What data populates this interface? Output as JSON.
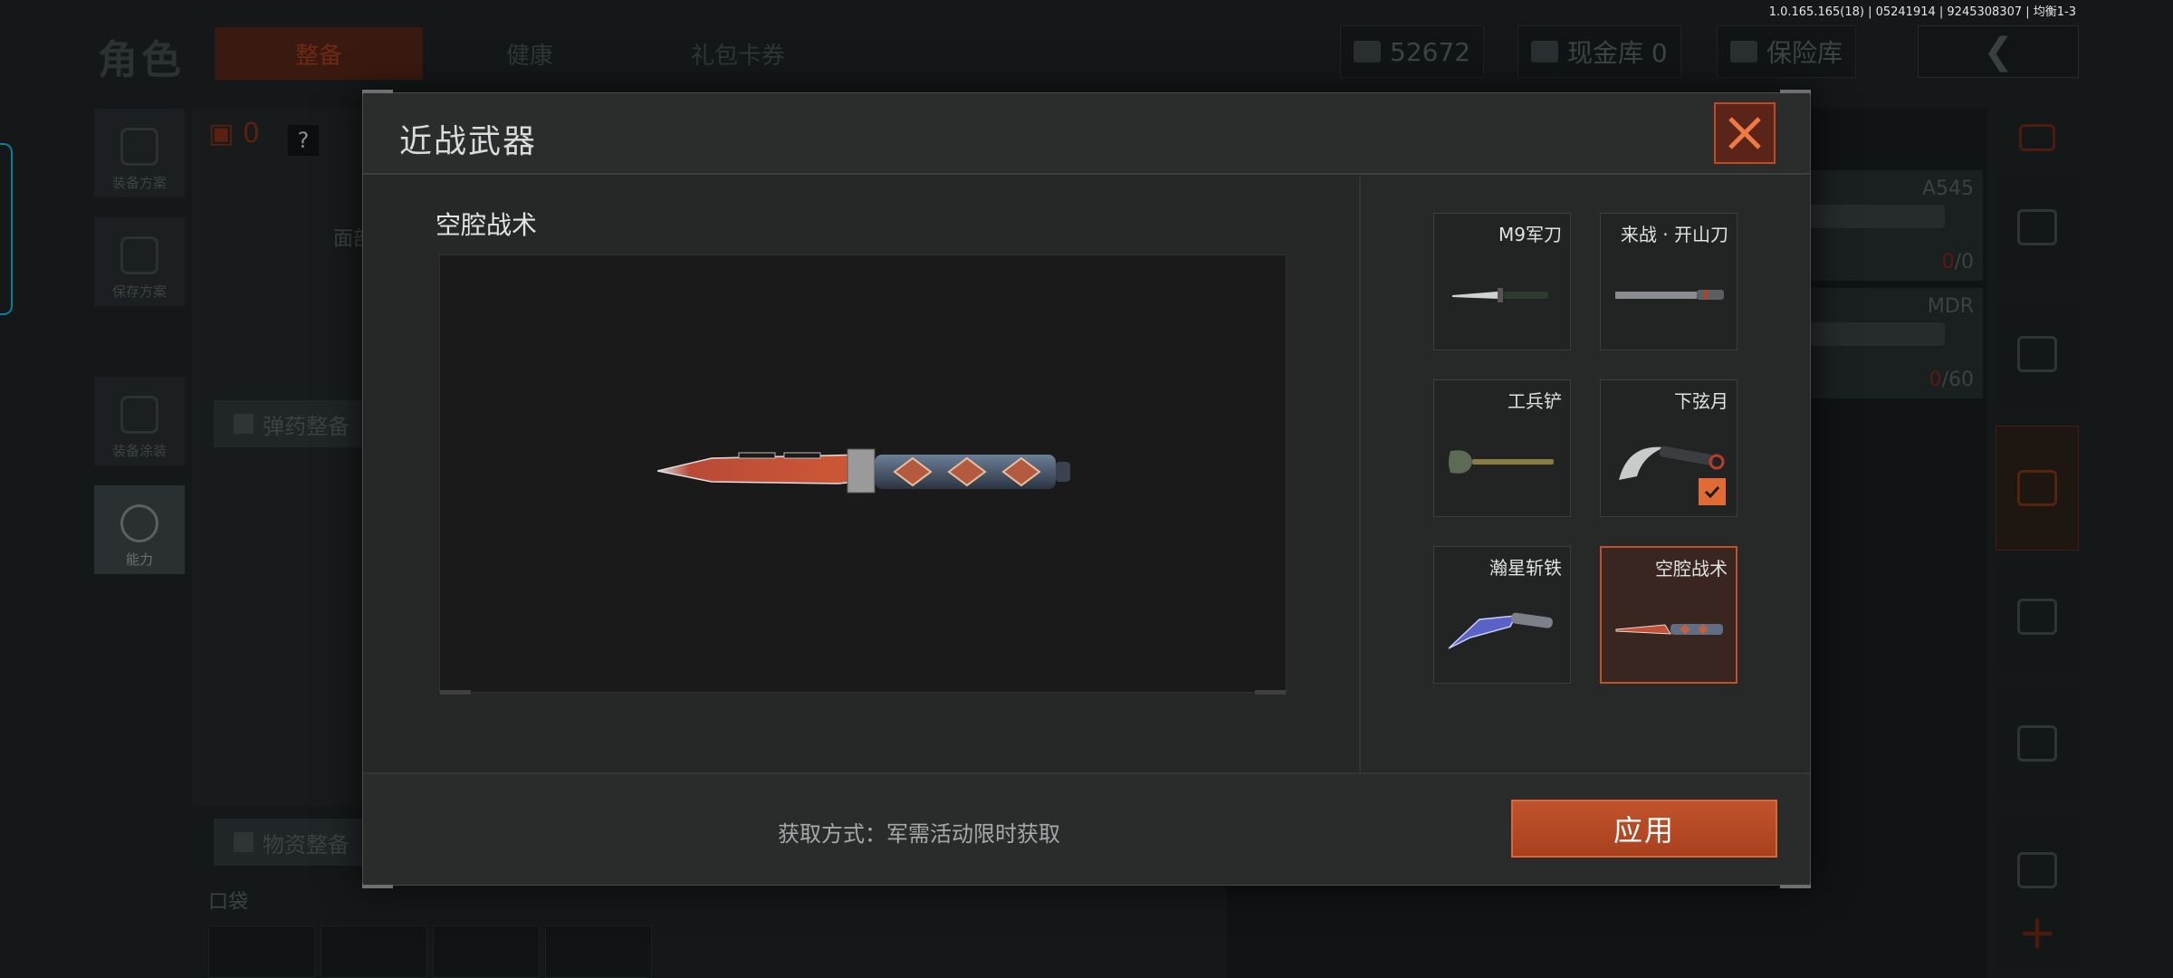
{
  "version": "1.0.165.165(18) | 05241914 | 9245308307 | 均衡1-3",
  "background": {
    "title": "角色",
    "tabs": [
      "整备",
      "健康",
      "礼包卡券"
    ],
    "currency_amount": "52672",
    "cash_vault": "现金库 0",
    "safe_vault": "保险库",
    "left_nav": [
      "装备方案",
      "保存方案",
      "装备涂装",
      "能力"
    ],
    "helmet_count": "0",
    "help": "?",
    "ammo_button": "弹药整备",
    "supply_button": "物资整备",
    "pocket_label": "口袋",
    "partial_label": "面部",
    "weapons": [
      {
        "name": "A545",
        "ammo_current": "0",
        "ammo_total": "/0"
      },
      {
        "name": "MDR",
        "ammo_current": "0",
        "ammo_total": "/60"
      }
    ],
    "right_nav_plus": "+"
  },
  "modal": {
    "title": "近战武器",
    "close_icon": "close-x-icon",
    "preview": {
      "title": "空腔战术"
    },
    "items": [
      {
        "label": "M9军刀",
        "icon": "bayonet-knife-icon",
        "selected": false,
        "equipped": false
      },
      {
        "label": "来战 · 开山刀",
        "icon": "machete-icon",
        "selected": false,
        "equipped": false
      },
      {
        "label": "工兵铲",
        "icon": "shovel-icon",
        "selected": false,
        "equipped": false
      },
      {
        "label": "下弦月",
        "icon": "karambit-icon",
        "selected": false,
        "equipped": true
      },
      {
        "label": "瀚星斩铁",
        "icon": "blue-blade-icon",
        "selected": false,
        "equipped": false
      },
      {
        "label": "空腔战术",
        "icon": "tactical-knife-icon",
        "selected": true,
        "equipped": false
      }
    ],
    "acquire_text": "获取方式：军需活动限时获取",
    "apply_label": "应用"
  },
  "colors": {
    "accent_orange": "#c1532b",
    "check_orange": "#e06b35",
    "modal_bg": "#252626"
  }
}
